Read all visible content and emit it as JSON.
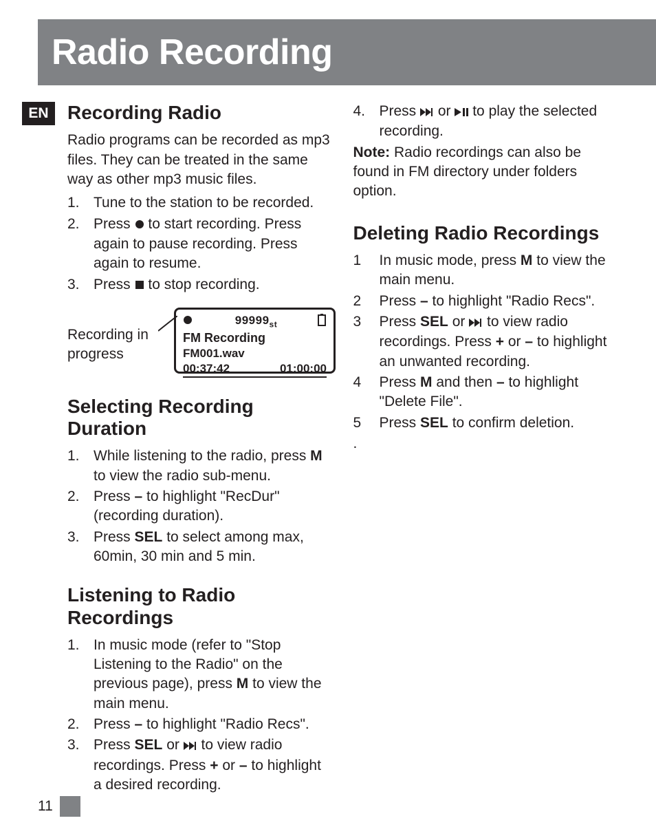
{
  "page": {
    "lang_badge": "EN",
    "title": "Radio Recording",
    "page_number": "11"
  },
  "left": {
    "h2_a": "Recording Radio",
    "intro": "Radio programs can be recorded as mp3 files. They can be treated in the same way as other mp3 music files.",
    "steps_a": [
      {
        "n": "1.",
        "pre": "Tune to the station to be recorded."
      },
      {
        "n": "2.",
        "pre": "Press ",
        "icon": "record",
        "post": " to start recording. Press again to pause recording. Press again to resume."
      },
      {
        "n": "3.",
        "pre": "Press ",
        "icon": "stop",
        "post": " to stop recording."
      }
    ],
    "screen": {
      "caption_l1": "Recording in",
      "caption_l2": "progress",
      "station": "99999",
      "station_suffix": "st",
      "title": "FM Recording",
      "file": "FM001.wav",
      "elapsed": "00:37:42",
      "duration": "01:00:00"
    },
    "h2_b": "Selecting Recording Duration",
    "steps_b": [
      {
        "n": "1.",
        "t": "While listening to the radio, press ",
        "bold": "M",
        "post": " to view the radio sub-menu."
      },
      {
        "n": "2.",
        "t": "Press ",
        "bold": "–",
        "post": " to highlight \"RecDur\" (recording duration)."
      },
      {
        "n": "3.",
        "t": "Press ",
        "bold": "SEL",
        "post": " to select among max, 60min, 30 min and 5 min."
      }
    ],
    "h2_c": "Listening to Radio Recordings",
    "steps_c": [
      {
        "n": "1.",
        "t": "In music mode (refer to \"Stop Listening to the Radio\" on the previous page), press ",
        "bold": "M",
        "post": " to view the main menu."
      },
      {
        "n": "2.",
        "t": "Press ",
        "bold": "–",
        "post": " to highlight \"Radio Recs\"."
      },
      {
        "n": "3.",
        "t": "Press ",
        "bold": "SEL",
        "mid": " or ",
        "icon": "ffwd",
        "post2": " to view radio recordings. Press ",
        "bold2": "+",
        "mid2": " or ",
        "bold3": "–",
        "post3": " to highlight a desired recording."
      }
    ]
  },
  "right": {
    "step4": {
      "n": "4.",
      "t": "Press ",
      "icon1": "ffwd",
      "mid": " or ",
      "icon2": "playpause",
      "post": " to play the selected recording."
    },
    "note_label": "Note:",
    "note_text": " Radio recordings can also be found in FM directory under folders option.",
    "h2_d": "Deleting Radio Recordings",
    "steps_d": [
      {
        "n": "1",
        "t": "In music mode, press ",
        "bold": "M",
        "post": " to view the main menu."
      },
      {
        "n": "2",
        "t": "Press ",
        "bold": "–",
        "post": " to highlight \"Radio Recs\"."
      },
      {
        "n": "3",
        "t": "Press ",
        "bold": "SEL",
        "mid": " or ",
        "icon": "ffwd",
        "post2": " to view radio recordings. Press ",
        "bold2": "+",
        "mid2": " or ",
        "bold3": "–",
        "post3": " to highlight an unwanted recording."
      },
      {
        "n": "4",
        "t": "Press ",
        "bold": "M",
        "mid": " and then ",
        "bold2": "–",
        "post": " to highlight \"Delete File\"."
      },
      {
        "n": "5",
        "t": "Press ",
        "bold": "SEL",
        "post": " to confirm deletion."
      }
    ],
    "trailing_dot": "."
  }
}
